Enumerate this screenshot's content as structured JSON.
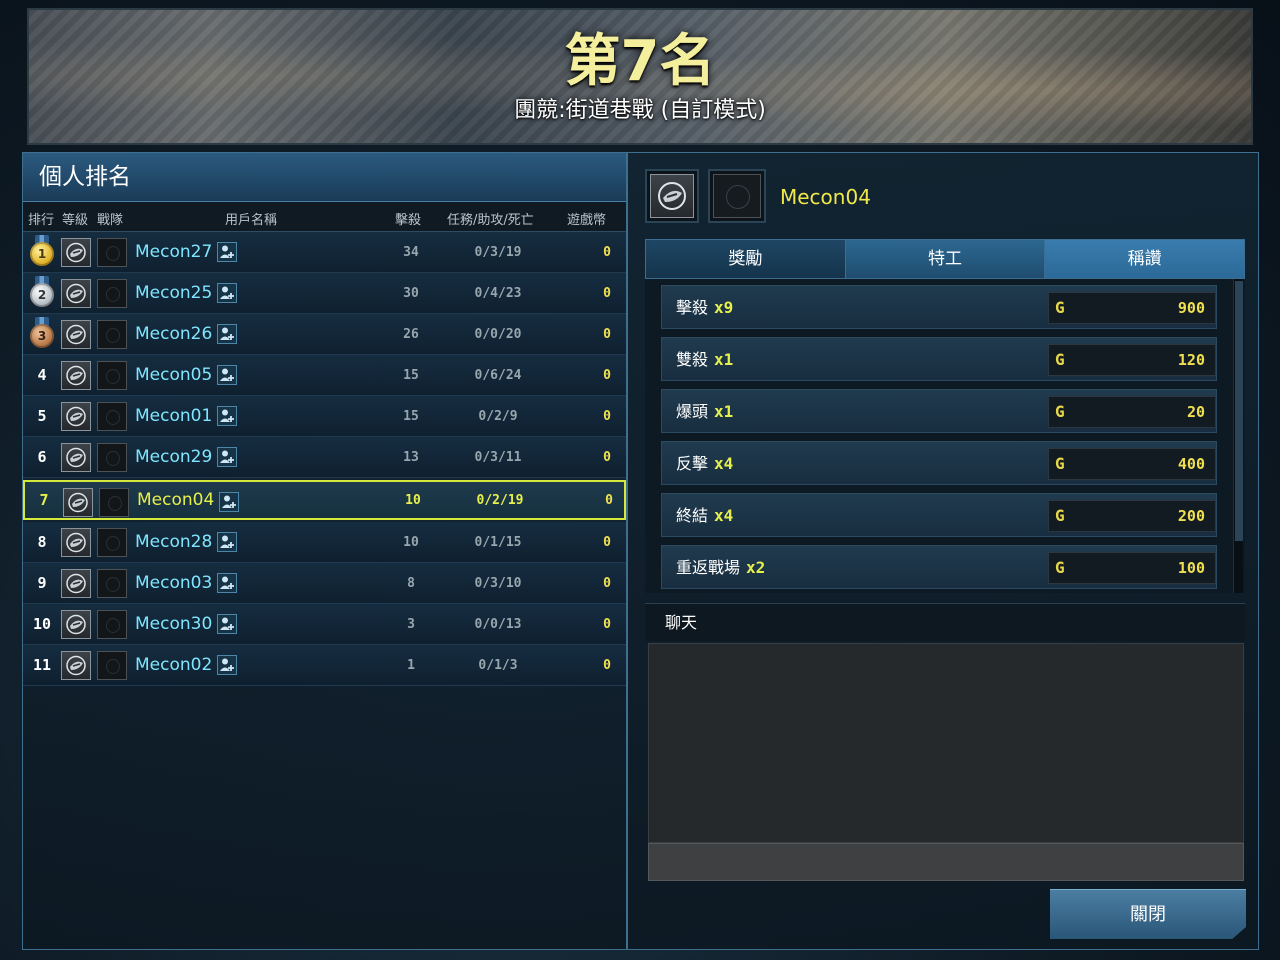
{
  "header": {
    "rank_title": "第7名",
    "mode_title": "團競:街道巷戰 (自訂模式)"
  },
  "ranking": {
    "title": "個人排名",
    "columns": {
      "rank": "排行",
      "level": "等級",
      "clan": "戰隊",
      "username": "用戶名稱",
      "kills": "擊殺",
      "kda": "任務/助攻/死亡",
      "coins": "遊戲幣"
    },
    "rows": [
      {
        "rank": "1",
        "medal": "gold",
        "name": "Mecon27",
        "kills": "34",
        "kda": "0/3/19",
        "coins": "0"
      },
      {
        "rank": "2",
        "medal": "silver",
        "name": "Mecon25",
        "kills": "30",
        "kda": "0/4/23",
        "coins": "0"
      },
      {
        "rank": "3",
        "medal": "bronze",
        "name": "Mecon26",
        "kills": "26",
        "kda": "0/0/20",
        "coins": "0"
      },
      {
        "rank": "4",
        "medal": "",
        "name": "Mecon05",
        "kills": "15",
        "kda": "0/6/24",
        "coins": "0"
      },
      {
        "rank": "5",
        "medal": "",
        "name": "Mecon01",
        "kills": "15",
        "kda": "0/2/9",
        "coins": "0"
      },
      {
        "rank": "6",
        "medal": "",
        "name": "Mecon29",
        "kills": "13",
        "kda": "0/3/11",
        "coins": "0"
      },
      {
        "rank": "7",
        "medal": "",
        "name": "Mecon04",
        "kills": "10",
        "kda": "0/2/19",
        "coins": "0",
        "highlight": true
      },
      {
        "rank": "8",
        "medal": "",
        "name": "Mecon28",
        "kills": "10",
        "kda": "0/1/15",
        "coins": "0"
      },
      {
        "rank": "9",
        "medal": "",
        "name": "Mecon03",
        "kills": "8",
        "kda": "0/3/10",
        "coins": "0"
      },
      {
        "rank": "10",
        "medal": "",
        "name": "Mecon30",
        "kills": "3",
        "kda": "0/0/13",
        "coins": "0"
      },
      {
        "rank": "11",
        "medal": "",
        "name": "Mecon02",
        "kills": "1",
        "kda": "0/1/3",
        "coins": "0"
      }
    ]
  },
  "profile": {
    "name": "Mecon04"
  },
  "tabs": [
    "獎勵",
    "特工",
    "稱讚"
  ],
  "rewards": [
    {
      "name": "擊殺",
      "mult": "x9",
      "currency": "G",
      "value": "900"
    },
    {
      "name": "雙殺",
      "mult": "x1",
      "currency": "G",
      "value": "120"
    },
    {
      "name": "爆頭",
      "mult": "x1",
      "currency": "G",
      "value": "20"
    },
    {
      "name": "反擊",
      "mult": "x4",
      "currency": "G",
      "value": "400"
    },
    {
      "name": "終結",
      "mult": "x4",
      "currency": "G",
      "value": "200"
    },
    {
      "name": "重返戰場",
      "mult": "x2",
      "currency": "G",
      "value": "100"
    }
  ],
  "chat": {
    "title": "聊天"
  },
  "close_label": "關閉",
  "colors": {
    "highlight": "#d6e83a",
    "username": "#7fe6ff",
    "gold_text": "#f0e050"
  }
}
